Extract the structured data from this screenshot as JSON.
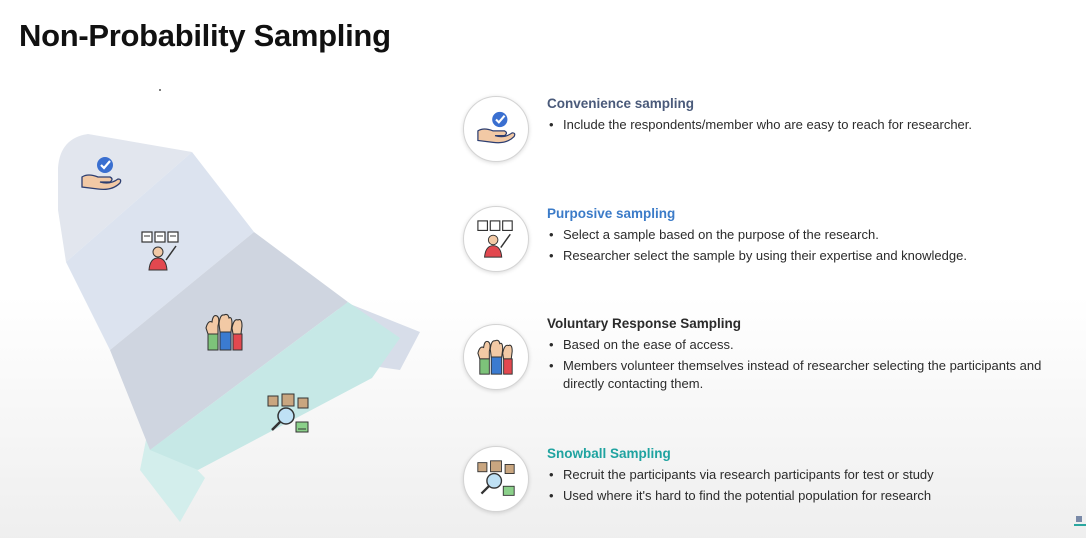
{
  "page": {
    "title": "Non-Probability Sampling"
  },
  "methods": [
    {
      "title": "Convenience sampling",
      "color": "#4a5a7a",
      "bullets": [
        "Include the respondents/member who are easy to reach for researcher."
      ]
    },
    {
      "title": "Purposive sampling",
      "color": "#3b7bc8",
      "bullets": [
        "Select a sample based on the purpose of the research.",
        "Researcher select the sample by using their expertise and knowledge."
      ]
    },
    {
      "title": "Voluntary  Response Sampling",
      "color": "#2b2b2b",
      "bullets": [
        "Based on the ease of access.",
        "Members volunteer themselves instead of researcher selecting the participants and directly contacting them."
      ]
    },
    {
      "title": "Snowball Sampling",
      "color": "#1fa3a0",
      "bullets": [
        "Recruit the participants via research participants for test or study",
        "Used where it's hard to find the potential population for research"
      ]
    }
  ],
  "icons": [
    "hand-check-icon",
    "presenter-board-icon",
    "raised-hands-icon",
    "network-search-icon"
  ],
  "colors": {
    "rocket_light": "#dfe4ee",
    "rocket_mid": "#cfd6e3",
    "rocket_teal": "#bfe6e4"
  }
}
